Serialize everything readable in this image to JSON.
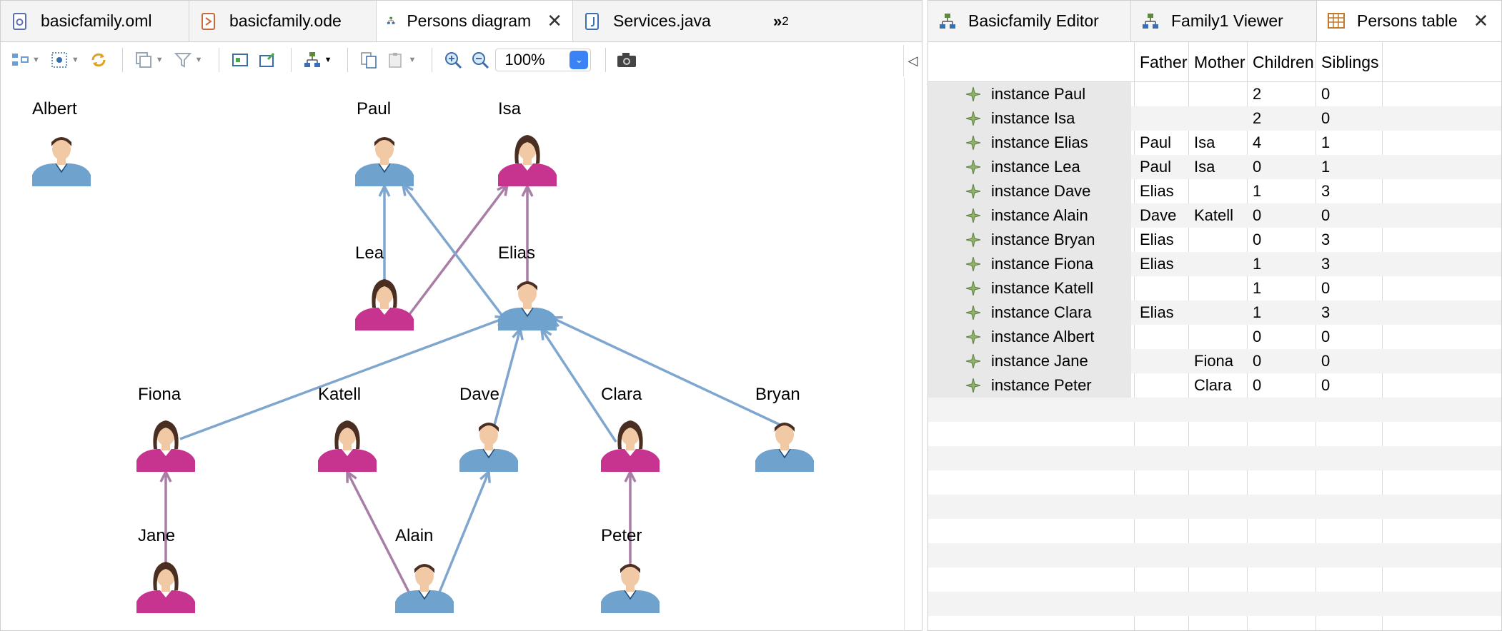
{
  "left_tabs": [
    {
      "label": "basicfamily.oml",
      "icon": "oml-file-icon",
      "active": false
    },
    {
      "label": "basicfamily.ode",
      "icon": "ode-file-icon",
      "active": false
    },
    {
      "label": "Persons diagram",
      "icon": "diagram-icon",
      "active": true
    },
    {
      "label": "Services.java",
      "icon": "java-file-icon",
      "active": false
    }
  ],
  "left_overflow": {
    "chevron": "»",
    "count": "2"
  },
  "toolbar": {
    "zoom_value": "100%"
  },
  "right_tabs": [
    {
      "label": "Basicfamily Editor",
      "icon": "editor-icon",
      "active": false
    },
    {
      "label": "Family1 Viewer",
      "icon": "viewer-icon",
      "active": false
    },
    {
      "label": "Persons table",
      "icon": "table-icon",
      "active": true
    }
  ],
  "diagram": {
    "persons": [
      {
        "id": "albert",
        "name": "Albert",
        "gender": "male"
      },
      {
        "id": "paul",
        "name": "Paul",
        "gender": "male"
      },
      {
        "id": "isa",
        "name": "Isa",
        "gender": "female"
      },
      {
        "id": "lea",
        "name": "Lea",
        "gender": "female"
      },
      {
        "id": "elias",
        "name": "Elias",
        "gender": "male"
      },
      {
        "id": "fiona",
        "name": "Fiona",
        "gender": "female"
      },
      {
        "id": "katell",
        "name": "Katell",
        "gender": "female"
      },
      {
        "id": "dave",
        "name": "Dave",
        "gender": "male"
      },
      {
        "id": "clara",
        "name": "Clara",
        "gender": "female"
      },
      {
        "id": "bryan",
        "name": "Bryan",
        "gender": "male"
      },
      {
        "id": "jane",
        "name": "Jane",
        "gender": "female"
      },
      {
        "id": "alain",
        "name": "Alain",
        "gender": "male"
      },
      {
        "id": "peter",
        "name": "Peter",
        "gender": "male"
      }
    ],
    "relations": [
      {
        "child": "lea",
        "parent": "paul",
        "role": "father"
      },
      {
        "child": "lea",
        "parent": "isa",
        "role": "mother"
      },
      {
        "child": "elias",
        "parent": "paul",
        "role": "father"
      },
      {
        "child": "elias",
        "parent": "isa",
        "role": "mother"
      },
      {
        "child": "fiona",
        "parent": "elias",
        "role": "father"
      },
      {
        "child": "dave",
        "parent": "elias",
        "role": "father"
      },
      {
        "child": "clara",
        "parent": "elias",
        "role": "father"
      },
      {
        "child": "bryan",
        "parent": "elias",
        "role": "father"
      },
      {
        "child": "jane",
        "parent": "fiona",
        "role": "mother"
      },
      {
        "child": "alain",
        "parent": "katell",
        "role": "mother"
      },
      {
        "child": "alain",
        "parent": "dave",
        "role": "father"
      },
      {
        "child": "peter",
        "parent": "clara",
        "role": "mother"
      }
    ],
    "colors": {
      "father_edge": "#7fa6cf",
      "mother_edge": "#a87ea6",
      "male_body": "#6fa3cd",
      "female_body": "#c7348f",
      "hair": "#4a2e22",
      "skin": "#f1c9a5"
    }
  },
  "table": {
    "columns": [
      "",
      "Father",
      "Mother",
      "Children",
      "Siblings"
    ],
    "rows": [
      {
        "name": "instance Paul",
        "father": "",
        "mother": "",
        "children": "2",
        "siblings": "0"
      },
      {
        "name": "instance Isa",
        "father": "",
        "mother": "",
        "children": "2",
        "siblings": "0"
      },
      {
        "name": "instance Elias",
        "father": "Paul",
        "mother": "Isa",
        "children": "4",
        "siblings": "1"
      },
      {
        "name": "instance Lea",
        "father": "Paul",
        "mother": "Isa",
        "children": "0",
        "siblings": "1"
      },
      {
        "name": "instance Dave",
        "father": "Elias",
        "mother": "",
        "children": "1",
        "siblings": "3"
      },
      {
        "name": "instance Alain",
        "father": "Dave",
        "mother": "Katell",
        "children": "0",
        "siblings": "0"
      },
      {
        "name": "instance Bryan",
        "father": "Elias",
        "mother": "",
        "children": "0",
        "siblings": "3"
      },
      {
        "name": "instance Fiona",
        "father": "Elias",
        "mother": "",
        "children": "1",
        "siblings": "3"
      },
      {
        "name": "instance Katell",
        "father": "",
        "mother": "",
        "children": "1",
        "siblings": "0"
      },
      {
        "name": "instance Clara",
        "father": "Elias",
        "mother": "",
        "children": "1",
        "siblings": "3"
      },
      {
        "name": "instance Albert",
        "father": "",
        "mother": "",
        "children": "0",
        "siblings": "0"
      },
      {
        "name": "instance Jane",
        "father": "",
        "mother": "Fiona",
        "children": "0",
        "siblings": "0"
      },
      {
        "name": "instance Peter",
        "father": "",
        "mother": "Clara",
        "children": "0",
        "siblings": "0"
      }
    ],
    "row_icon": "instance-diamond-icon"
  }
}
